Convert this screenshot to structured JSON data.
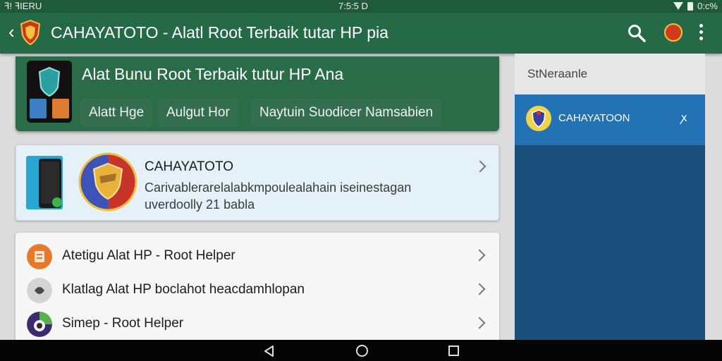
{
  "status_bar": {
    "left_text": "ꟻ! ꟻIERU",
    "time": "7:5:5 D",
    "battery_text": "0:c%"
  },
  "app_bar": {
    "back_icon": "chevron-left-icon",
    "title": "CAHAYATOTO - Alatl Root Terbaik tutar HP pia",
    "actions": [
      "search-icon",
      "avatar",
      "more-vert-icon"
    ]
  },
  "hero": {
    "title": "Alat Bunu Root Terbaik tutur HP Ana",
    "chips": [
      "Alatt Hge",
      "Aulgut Hor",
      "Naytuin Suodicer Namsabien"
    ]
  },
  "featured": {
    "name": "CAHAYATOTO",
    "description": "Carivablerarelalabkmpoulealahain iseinestagan uverdoolly 21 babla"
  },
  "list": {
    "items": [
      {
        "label": "Atetigu  Alat HP - Root Helper",
        "icon": "app-icon-orange"
      },
      {
        "label": "Klatlag  Alat HP boclahot heacdamhlopan",
        "icon": "app-icon-gray"
      },
      {
        "label": "Simep - Root Helper",
        "icon": "app-icon-purple"
      }
    ]
  },
  "side_panel": {
    "header": "StNeraanle",
    "item": {
      "label": "CAHAYATOON",
      "pin": "ꭗ"
    }
  },
  "colors": {
    "status_bar": "#1f5a3a",
    "app_bar": "#256a46",
    "hero": "#2a6b48",
    "featured_bg": "#e4f1f8",
    "side_panel": "#1b4f7b",
    "side_item": "#2272b4"
  }
}
